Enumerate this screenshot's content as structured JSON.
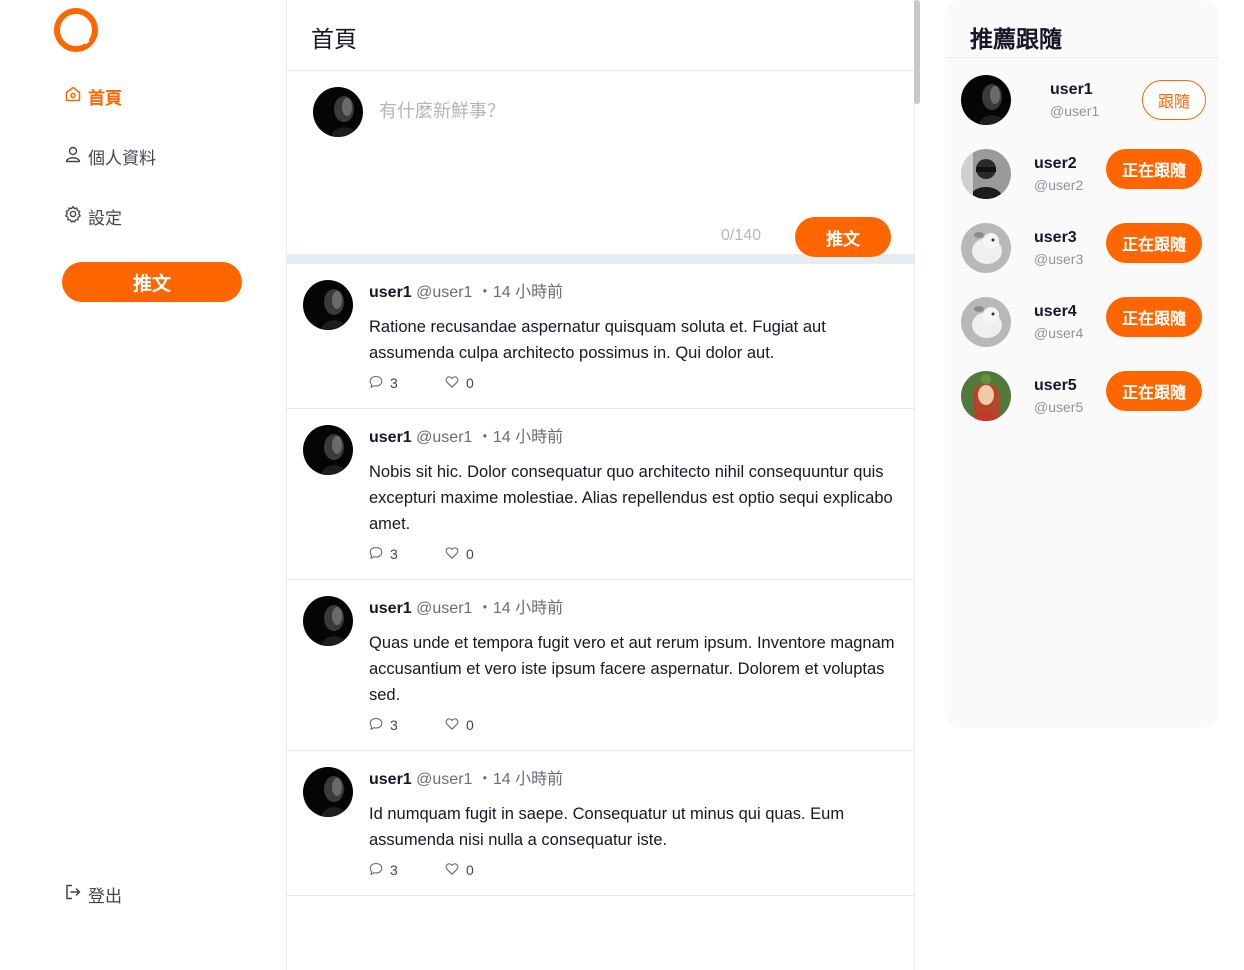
{
  "theme": {
    "accent": "#ff6600",
    "divider": "#e6ecf0",
    "panel_bg": "#fafafb"
  },
  "sidebar": {
    "logo_icon": "alpha-logo-icon",
    "items": [
      {
        "label": "首頁",
        "icon": "home-icon",
        "active": true
      },
      {
        "label": "個人資料",
        "icon": "user-icon",
        "active": false
      },
      {
        "label": "設定",
        "icon": "gear-icon",
        "active": false
      }
    ],
    "tweet_button": "推文",
    "logout": {
      "label": "登出",
      "icon": "logout-icon"
    }
  },
  "main": {
    "title": "首頁",
    "compose": {
      "placeholder": "有什麼新鮮事？",
      "counter": "0/140",
      "button": "推文"
    },
    "tweets": [
      {
        "name": "user1",
        "handle": "@user1",
        "time": "・14 小時前",
        "text": "Ratione recusandae aspernatur quisquam soluta et. Fugiat aut assumenda culpa architecto possimus in. Qui dolor aut.",
        "replies": "3",
        "likes": "0"
      },
      {
        "name": "user1",
        "handle": "@user1",
        "time": "・14 小時前",
        "text": "Nobis sit hic. Dolor consequatur quo architecto nihil consequuntur quis excepturi maxime molestiae. Alias repellendus est optio sequi explicabo amet.",
        "replies": "3",
        "likes": "0"
      },
      {
        "name": "user1",
        "handle": "@user1",
        "time": "・14 小時前",
        "text": "Quas unde et tempora fugit vero et aut rerum ipsum. Inventore magnam accusantium et vero iste ipsum facere aspernatur. Dolorem et voluptas sed.",
        "replies": "3",
        "likes": "0"
      },
      {
        "name": "user1",
        "handle": "@user1",
        "time": "・14 小時前",
        "text": "Id numquam fugit in saepe. Consequatur ut minus qui quas. Eum assumenda nisi nulla a consequatur iste.",
        "replies": "3",
        "likes": "0"
      }
    ]
  },
  "recommend": {
    "title": "推薦跟隨",
    "users": [
      {
        "name": "user1",
        "handle": "@user1",
        "button": "跟隨",
        "following": false
      },
      {
        "name": "user2",
        "handle": "@user2",
        "button": "正在跟隨",
        "following": true
      },
      {
        "name": "user3",
        "handle": "@user3",
        "button": "正在跟隨",
        "following": true
      },
      {
        "name": "user4",
        "handle": "@user4",
        "button": "正在跟隨",
        "following": true
      },
      {
        "name": "user5",
        "handle": "@user5",
        "button": "正在跟隨",
        "following": true
      }
    ]
  }
}
